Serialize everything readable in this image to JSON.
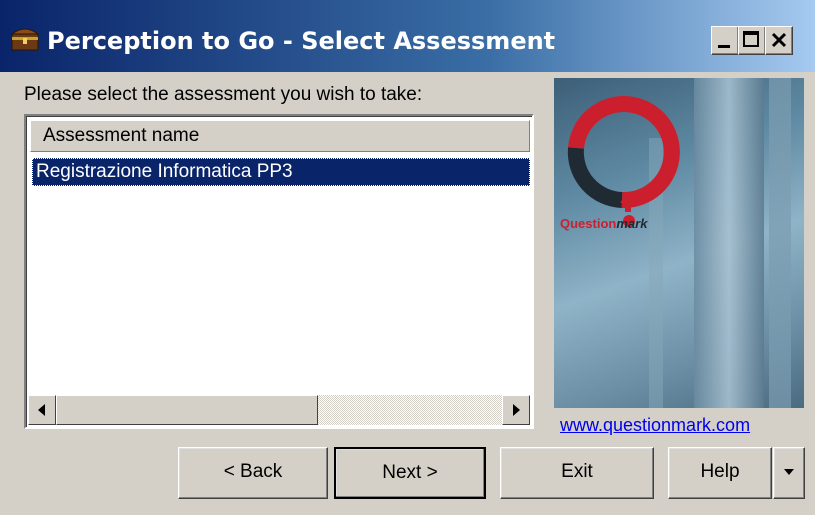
{
  "window": {
    "title": "Perception to Go - Select Assessment"
  },
  "prompt": "Please select the assessment you wish to take:",
  "list": {
    "column_header": "Assessment name",
    "items": [
      {
        "label": "Registrazione Informatica PP3",
        "selected": true
      }
    ]
  },
  "logo": {
    "brand_label": "Questionmark",
    "url": "www.questionmark.com"
  },
  "buttons": {
    "back": "< Back",
    "next": "Next >",
    "exit": "Exit",
    "help": "Help"
  },
  "colors": {
    "title_gradient_start": "#0a246a",
    "selection": "#0a246a",
    "logo_red": "#cc1f2d",
    "link": "#0000ee"
  },
  "icons": {
    "app": "treasure-chest-icon",
    "minimize": "minimize-icon",
    "maximize": "maximize-icon",
    "close": "close-icon"
  }
}
